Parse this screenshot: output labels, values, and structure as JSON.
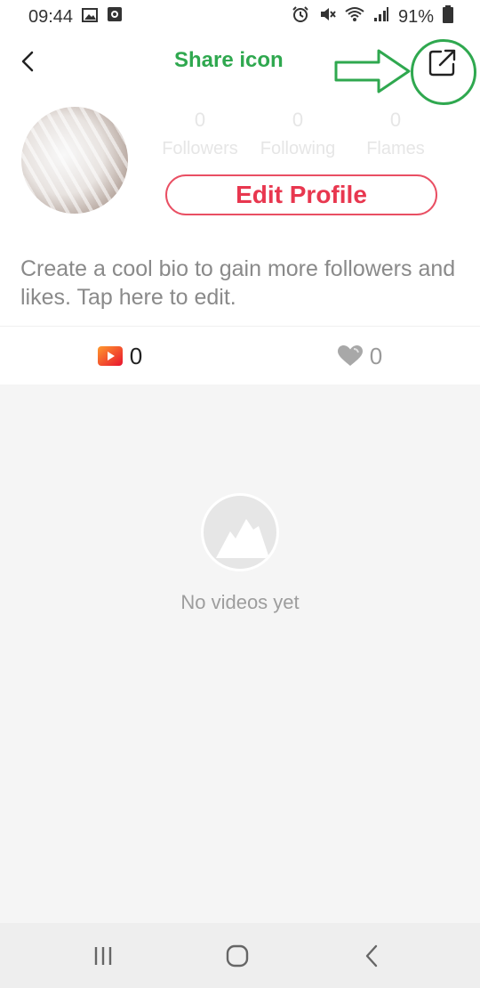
{
  "status_bar": {
    "time": "09:44",
    "battery": "91%",
    "icons_left": [
      "image-icon",
      "record-icon"
    ],
    "icons_right": [
      "alarm-icon",
      "mute-icon",
      "wifi-icon",
      "signal-icon",
      "battery-icon"
    ]
  },
  "annotation": {
    "label": "Share icon",
    "color": "#2fa84f"
  },
  "top_bar": {
    "back_icon": "back-arrow-icon",
    "share_icon": "share-icon"
  },
  "profile": {
    "stats": [
      {
        "count": "0",
        "label": "Followers"
      },
      {
        "count": "0",
        "label": "Following"
      },
      {
        "count": "0",
        "label": "Flames"
      }
    ],
    "edit_profile_label": "Edit Profile",
    "bio_placeholder": "Create a cool bio to gain more followers and likes. Tap here to edit."
  },
  "tabs": [
    {
      "icon": "video-icon",
      "count": "0"
    },
    {
      "icon": "heart-icon",
      "count": "0"
    }
  ],
  "empty_state": {
    "text": "No videos yet"
  },
  "colors": {
    "accent": "#e8374f",
    "annotation": "#2fa84f"
  }
}
